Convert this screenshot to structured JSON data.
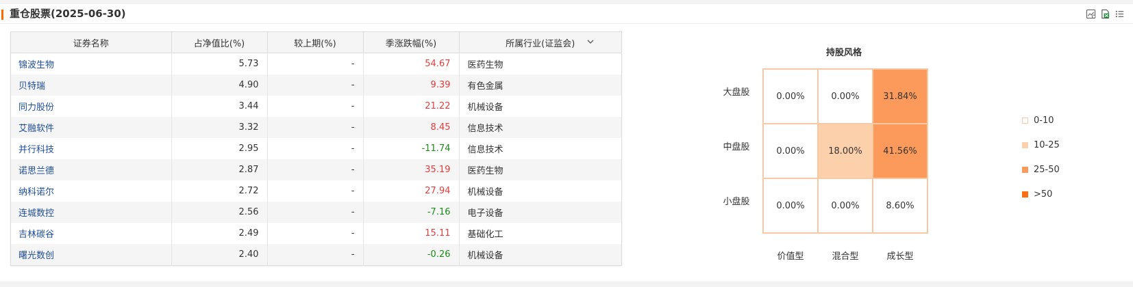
{
  "header": {
    "title": "重仓股票(2025-06-30)",
    "accent_color": "#ff6a00",
    "tools": [
      "chart-export-icon",
      "excel-export-icon",
      "list-menu-icon"
    ]
  },
  "table": {
    "columns": [
      "证券名称",
      "占净值比(%)",
      "较上期(%)",
      "季涨跌幅(%)",
      "所属行业(证监会)"
    ],
    "rows": [
      {
        "name": "锦波生物",
        "ratio": "5.73",
        "change": "-",
        "quarter": "54.67",
        "trend": "up",
        "industry": "医药生物"
      },
      {
        "name": "贝特瑞",
        "ratio": "4.90",
        "change": "-",
        "quarter": "9.39",
        "trend": "up",
        "industry": "有色金属"
      },
      {
        "name": "同力股份",
        "ratio": "3.44",
        "change": "-",
        "quarter": "21.22",
        "trend": "up",
        "industry": "机械设备"
      },
      {
        "name": "艾融软件",
        "ratio": "3.32",
        "change": "-",
        "quarter": "8.45",
        "trend": "up",
        "industry": "信息技术"
      },
      {
        "name": "并行科技",
        "ratio": "2.95",
        "change": "-",
        "quarter": "-11.74",
        "trend": "down",
        "industry": "信息技术"
      },
      {
        "name": "诺思兰德",
        "ratio": "2.87",
        "change": "-",
        "quarter": "35.19",
        "trend": "up",
        "industry": "医药生物"
      },
      {
        "name": "纳科诺尔",
        "ratio": "2.72",
        "change": "-",
        "quarter": "27.94",
        "trend": "up",
        "industry": "机械设备"
      },
      {
        "name": "连城数控",
        "ratio": "2.56",
        "change": "-",
        "quarter": "-7.16",
        "trend": "down",
        "industry": "电子设备"
      },
      {
        "name": "吉林碳谷",
        "ratio": "2.49",
        "change": "-",
        "quarter": "15.11",
        "trend": "up",
        "industry": "基础化工"
      },
      {
        "name": "曙光数创",
        "ratio": "2.40",
        "change": "-",
        "quarter": "-0.26",
        "trend": "down",
        "industry": "机械设备"
      }
    ],
    "colors": {
      "up": "#e83b3b",
      "down": "#1b8a1b",
      "link": "#1f4e9c"
    }
  },
  "style_box": {
    "title": "持股风格",
    "row_labels": [
      "大盘股",
      "中盘股",
      "小盘股"
    ],
    "col_labels": [
      "价值型",
      "混合型",
      "成长型"
    ],
    "cells": [
      [
        {
          "label": "0.00%",
          "value": 0.0
        },
        {
          "label": "0.00%",
          "value": 0.0
        },
        {
          "label": "31.84%",
          "value": 31.84
        }
      ],
      [
        {
          "label": "0.00%",
          "value": 0.0
        },
        {
          "label": "18.00%",
          "value": 18.0
        },
        {
          "label": "41.56%",
          "value": 41.56
        }
      ],
      [
        {
          "label": "0.00%",
          "value": 0.0
        },
        {
          "label": "0.00%",
          "value": 0.0
        },
        {
          "label": "8.60%",
          "value": 8.6
        }
      ]
    ],
    "legend": [
      {
        "label": "0-10",
        "color": "#ffffff"
      },
      {
        "label": "10-25",
        "color": "#fcd0ab"
      },
      {
        "label": "25-50",
        "color": "#fb9a5a"
      },
      {
        "label": ">50",
        "color": "#fb6d12"
      }
    ],
    "border_color": "#f6c9a4"
  }
}
